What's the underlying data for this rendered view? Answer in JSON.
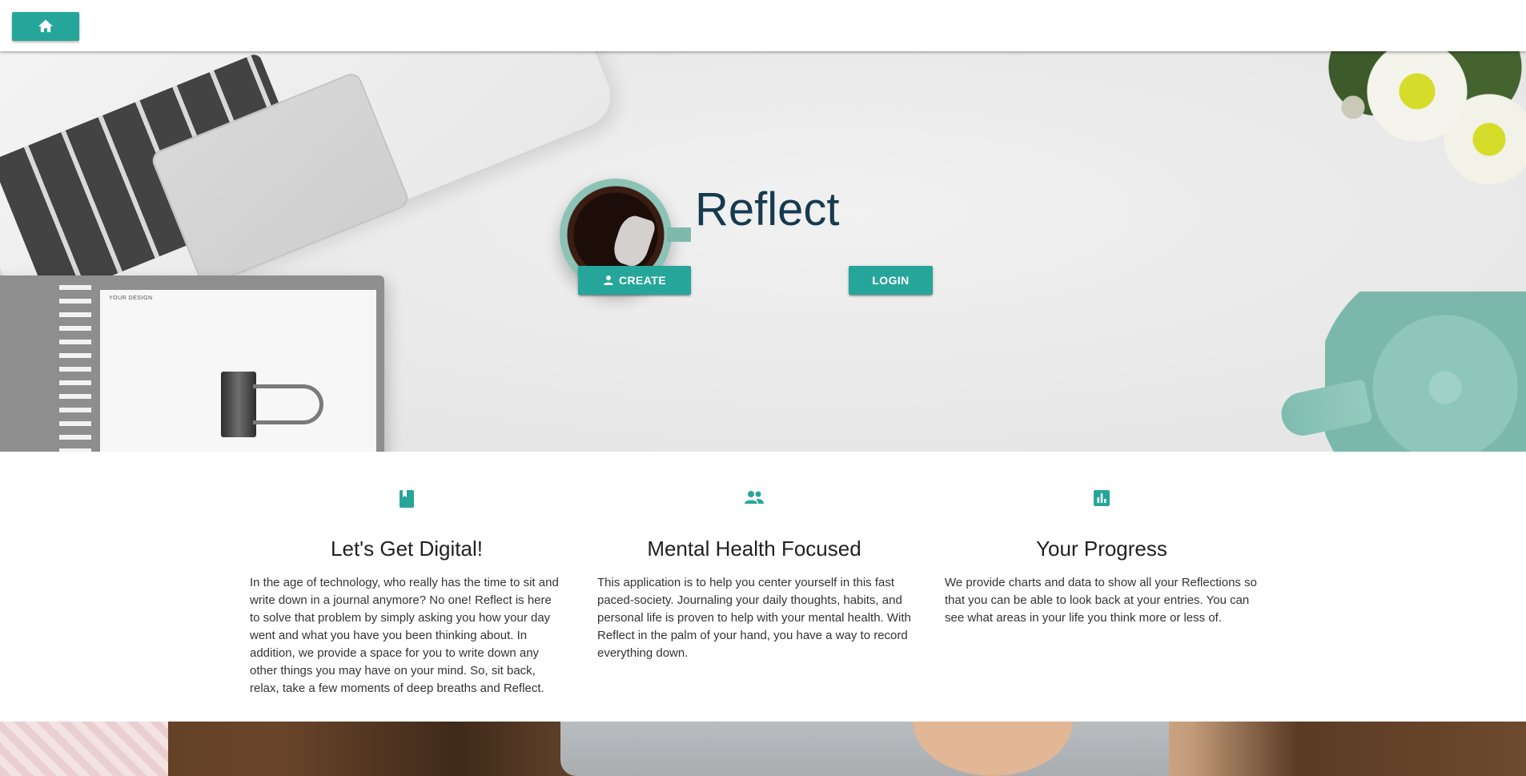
{
  "nav": {
    "home_icon": "home-icon"
  },
  "hero": {
    "title": "Reflect",
    "create_label": "CREATE",
    "create_icon": "person-icon",
    "login_label": "LOGIN",
    "notebook_label": "YOUR DESIGN"
  },
  "features": [
    {
      "icon": "book-icon",
      "title": "Let's Get Digital!",
      "text": "In the age of technology, who really has the time to sit and write down in a journal anymore? No one! Reflect is here to solve that problem by simply asking you how your day went and what you have you been thinking about. In addition, we provide a space for you to write down any other things you may have on your mind. So, sit back, relax, take a few moments of deep breaths and Reflect."
    },
    {
      "icon": "people-icon",
      "title": "Mental Health Focused",
      "text": "This application is to help you center yourself in this fast paced-society. Journaling your daily thoughts, habits, and personal life is proven to help with your mental health. With Reflect in the palm of your hand, you have a way to record everything down."
    },
    {
      "icon": "chart-icon",
      "title": "Your Progress",
      "text": "We provide charts and data to show all your Reflections so that you can be able to look back at your entries. You can see what areas in your life you think more or less of."
    }
  ],
  "colors": {
    "accent": "#26a69a",
    "title": "#163a4f"
  }
}
